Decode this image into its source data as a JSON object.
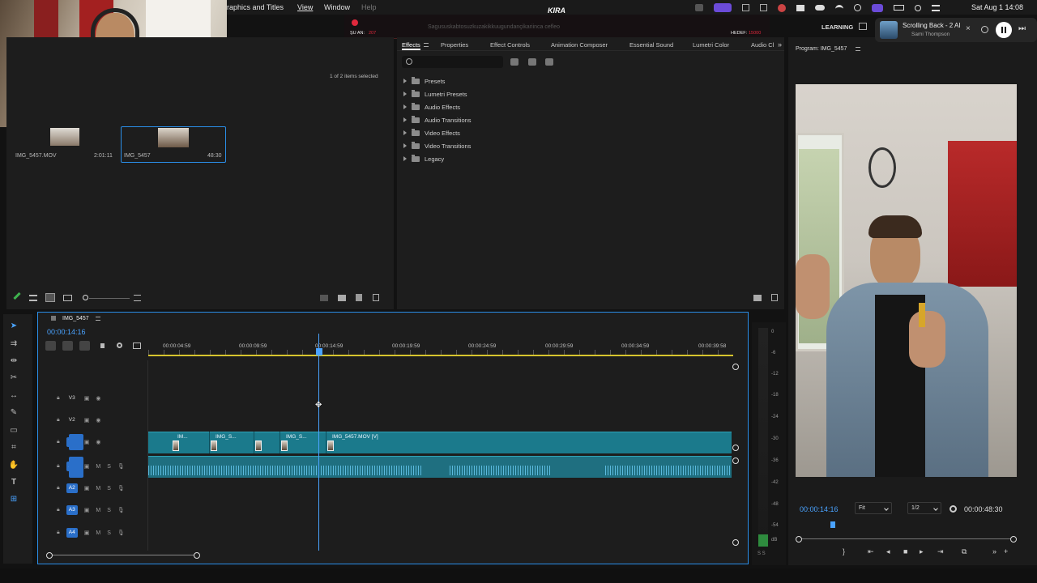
{
  "menu": {
    "graphics": "raphics and Titles",
    "view": "View",
    "window": "Window",
    "help": "Help"
  },
  "overlay": {
    "brand": "KIRA",
    "left_label": "ŞU AN:",
    "left_value": "207",
    "right_label": "HEDEF:",
    "right_value": "15000",
    "marquee": "Sagususkabtosuzkuzakikkuugundançikariinca   cefleo"
  },
  "macos": {
    "datetime": "Sat Aug 1  14:08",
    "workspace": "LEARNING",
    "now_playing_title": "Scrolling Back - 2 AI",
    "now_playing_artist": "Sami Thompson"
  },
  "project": {
    "items_selected": "1 of 2 items selected",
    "items": [
      {
        "name": "IMG_5457.MOV",
        "duration": "2:01:11"
      },
      {
        "name": "IMG_5457",
        "duration": "48:30"
      }
    ]
  },
  "effects_panel": {
    "tabs": [
      "Effects",
      "Properties",
      "Effect Controls",
      "Animation Composer",
      "Essential Sound",
      "Lumetri Color",
      "Audio Cl"
    ],
    "tree": [
      "Presets",
      "Lumetri Presets",
      "Audio Effects",
      "Audio Transitions",
      "Video Effects",
      "Video Transitions",
      "Legacy"
    ]
  },
  "program": {
    "title": "Program: IMG_5457",
    "current_time": "00:00:14:16",
    "fit": "Fit",
    "resolution": "1/2",
    "duration": "00:00:48:30",
    "playhead_position": 0.16
  },
  "timeline": {
    "sequence": "IMG_5457",
    "timecode": "00:00:14:16",
    "ruler": [
      "00:00:04:59",
      "00:00:09:59",
      "00:00:14:59",
      "00:00:19:59",
      "00:00:24:59",
      "00:00:29:59",
      "00:00:34:59",
      "00:00:39:58"
    ],
    "video_tracks": [
      "V3",
      "V2",
      "V1"
    ],
    "audio_tracks": [
      "A1",
      "A2",
      "A3",
      "A4"
    ],
    "clip_labels": [
      "IM...",
      "IMG_S...",
      "IMG_S...",
      "IMG_5457.MOV [V]"
    ],
    "track_mute": "M",
    "track_solo": "S"
  },
  "meter": {
    "labels": [
      "0",
      "-6",
      "-12",
      "-18",
      "-24",
      "-30",
      "-36",
      "-42",
      "-48",
      "-54",
      "dB"
    ],
    "footer": "S S"
  },
  "colors": {
    "accent": "#2a8ee8",
    "clip_video": "#1b7a8c",
    "clip_audio": "#1f6f80",
    "waveform": "#66c8f0"
  }
}
